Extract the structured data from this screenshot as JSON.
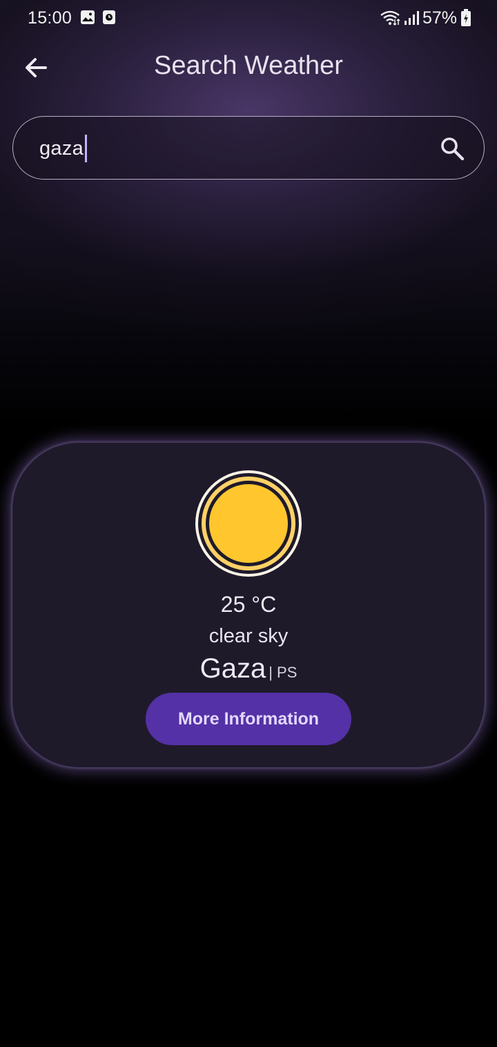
{
  "status_bar": {
    "time": "15:00",
    "battery": "57%",
    "icons": [
      "gallery-icon",
      "alarm-app-icon",
      "wifi-icon",
      "signal-icon",
      "battery-charging-icon"
    ]
  },
  "app_bar": {
    "title": "Search Weather",
    "back_icon": "arrow-left-icon"
  },
  "search": {
    "value": "gaza",
    "icon": "search-icon"
  },
  "weather_card": {
    "icon": "sun-icon",
    "temperature": "25 °C",
    "description": "clear sky",
    "city": "Gaza",
    "country": "| PS",
    "button_label": "More Information"
  },
  "colors": {
    "accent_button": "#5431a6",
    "sun_yellow": "#ffc62e",
    "card_bg": "#1f1a2a"
  }
}
